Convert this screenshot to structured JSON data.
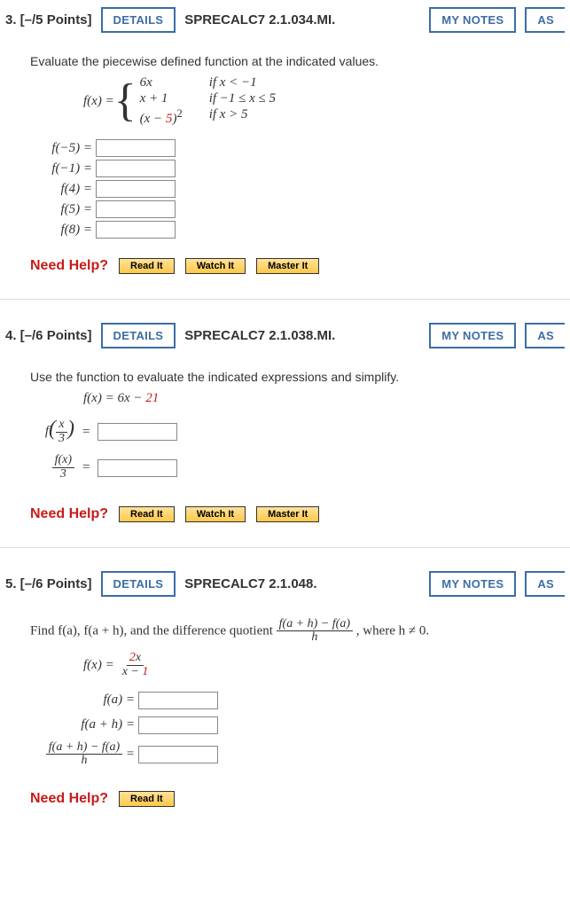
{
  "buttons": {
    "details": "DETAILS",
    "mynotes": "MY NOTES",
    "ask": "AS"
  },
  "help": {
    "label": "Need Help?",
    "read": "Read It",
    "watch": "Watch It",
    "master": "Master It"
  },
  "q3": {
    "points": "3.  [–/5 Points]",
    "source": "SPRECALC7 2.1.034.MI.",
    "instruction": "Evaluate the piecewise defined function at the indicated values.",
    "fxlabel": "f(x) = ",
    "cases": {
      "l1": "6x",
      "r1": "if x < −1",
      "l2": "x + 1",
      "r2": "if −1 ≤ x ≤ 5",
      "l3a": "(x − ",
      "l3b": "5",
      "l3c": ")",
      "l3sup": "2",
      "r3": "if x > 5"
    },
    "rows": [
      {
        "label": "f(−5)  ="
      },
      {
        "label": "f(−1)  ="
      },
      {
        "label": "f(4)  ="
      },
      {
        "label": "f(5)  ="
      },
      {
        "label": "f(8)  ="
      }
    ]
  },
  "q4": {
    "points": "4.  [–/6 Points]",
    "source": "SPRECALC7 2.1.038.MI.",
    "instruction": "Use the function to evaluate the indicated expressions and simplify.",
    "func_a": "f(x) = 6x − ",
    "func_b": "21",
    "row1_f": "f",
    "row1_x": "x",
    "row1_3": "3",
    "row1_eq": " = ",
    "row2_num": "f(x)",
    "row2_den": "3",
    "row2_eq": " = "
  },
  "q5": {
    "points": "5.  [–/6 Points]",
    "source": "SPRECALC7 2.1.048.",
    "instr_a": "Find  f(a), f(a + h),  and the difference quotient ",
    "dq_num": "f(a + h) − f(a)",
    "dq_den": "h",
    "instr_b": ",  where h ≠ 0.",
    "fx": "f(x) = ",
    "fx_num1": "2",
    "fx_num2": "x",
    "fx_den1": "x − ",
    "fx_den2": "1",
    "rows": {
      "r1": "f(a)  =",
      "r2": "f(a + h)  =",
      "r3_num": "f(a + h) − f(a)",
      "r3_den": "h",
      "r3_eq": "  ="
    }
  }
}
